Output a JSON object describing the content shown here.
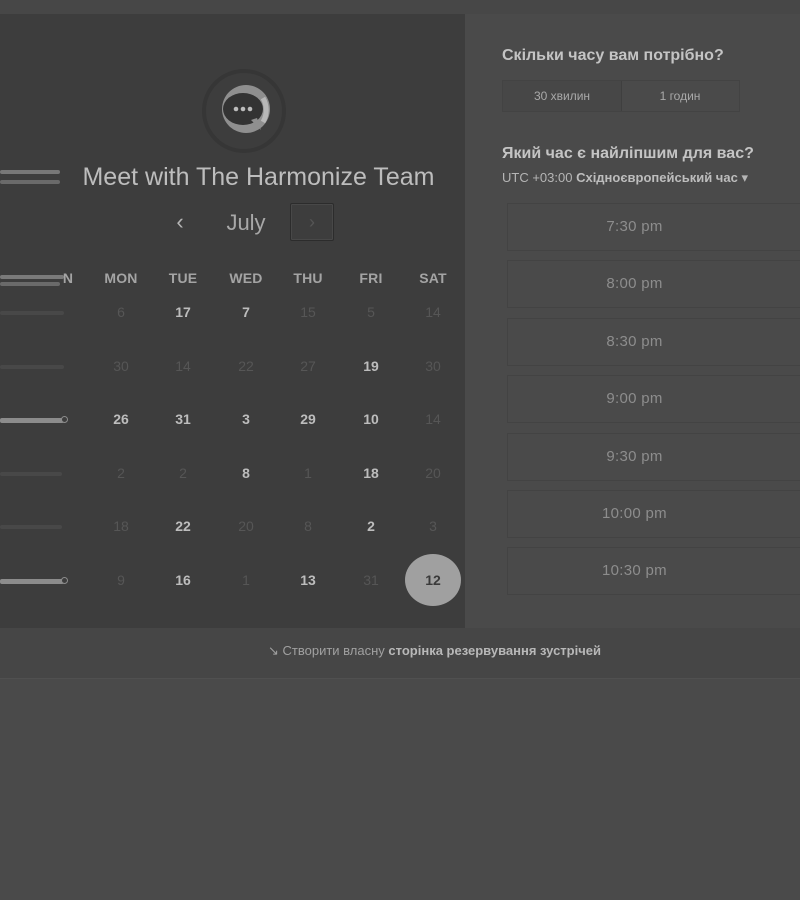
{
  "calendar": {
    "title": "Meet with The Harmonize Team",
    "month": "July",
    "prev": "‹",
    "next": "›",
    "weekdays": [
      "N",
      "MON",
      "TUE",
      "WED",
      "THU",
      "FRI",
      "SAT"
    ],
    "weeks": [
      [
        {
          "d": "6",
          "a": false
        },
        {
          "d": "17",
          "a": true
        },
        {
          "d": "7",
          "a": true
        },
        {
          "d": "15",
          "a": false
        },
        {
          "d": "5",
          "a": false
        },
        {
          "d": "14",
          "a": false
        }
      ],
      [
        {
          "d": "30",
          "a": false
        },
        {
          "d": "14",
          "a": false
        },
        {
          "d": "22",
          "a": false
        },
        {
          "d": "27",
          "a": false
        },
        {
          "d": "19",
          "a": true
        },
        {
          "d": "30",
          "a": false
        }
      ],
      [
        {
          "d": "26",
          "a": true
        },
        {
          "d": "31",
          "a": true
        },
        {
          "d": "3",
          "a": true
        },
        {
          "d": "29",
          "a": true
        },
        {
          "d": "10",
          "a": true
        },
        {
          "d": "14",
          "a": false
        }
      ],
      [
        {
          "d": "2",
          "a": false
        },
        {
          "d": "2",
          "a": false
        },
        {
          "d": "8",
          "a": true
        },
        {
          "d": "1",
          "a": false
        },
        {
          "d": "18",
          "a": true
        },
        {
          "d": "20",
          "a": false
        }
      ],
      [
        {
          "d": "18",
          "a": false
        },
        {
          "d": "22",
          "a": true
        },
        {
          "d": "20",
          "a": false
        },
        {
          "d": "8",
          "a": false
        },
        {
          "d": "2",
          "a": true
        },
        {
          "d": "3",
          "a": false
        }
      ],
      [
        {
          "d": "9",
          "a": false
        },
        {
          "d": "16",
          "a": true
        },
        {
          "d": "1",
          "a": false
        },
        {
          "d": "13",
          "a": true
        },
        {
          "d": "31",
          "a": false
        },
        {
          "d": "12",
          "a": true,
          "selected": true
        }
      ]
    ]
  },
  "duration": {
    "question": "Скільки часу вам потрібно?",
    "options": [
      "30 хвилин",
      "1 годин"
    ]
  },
  "time": {
    "question": "Який час є найліпшим для вас?",
    "timezone_prefix": "UTC +03:00",
    "timezone_name": "Східноєвропейський час",
    "dropdown": "▾",
    "slots": [
      "7:30 pm",
      "8:00 pm",
      "8:30 pm",
      "9:00 pm",
      "9:30 pm",
      "10:00 pm",
      "10:30 pm"
    ]
  },
  "footer": {
    "icon": "↘",
    "text": "Створити власну",
    "bold": "сторінка резервування зустрічей"
  },
  "colors": {
    "background": "#4a4a4a",
    "calendar_panel": "#3d3d3d",
    "selected_day": "#a0a0a0"
  }
}
